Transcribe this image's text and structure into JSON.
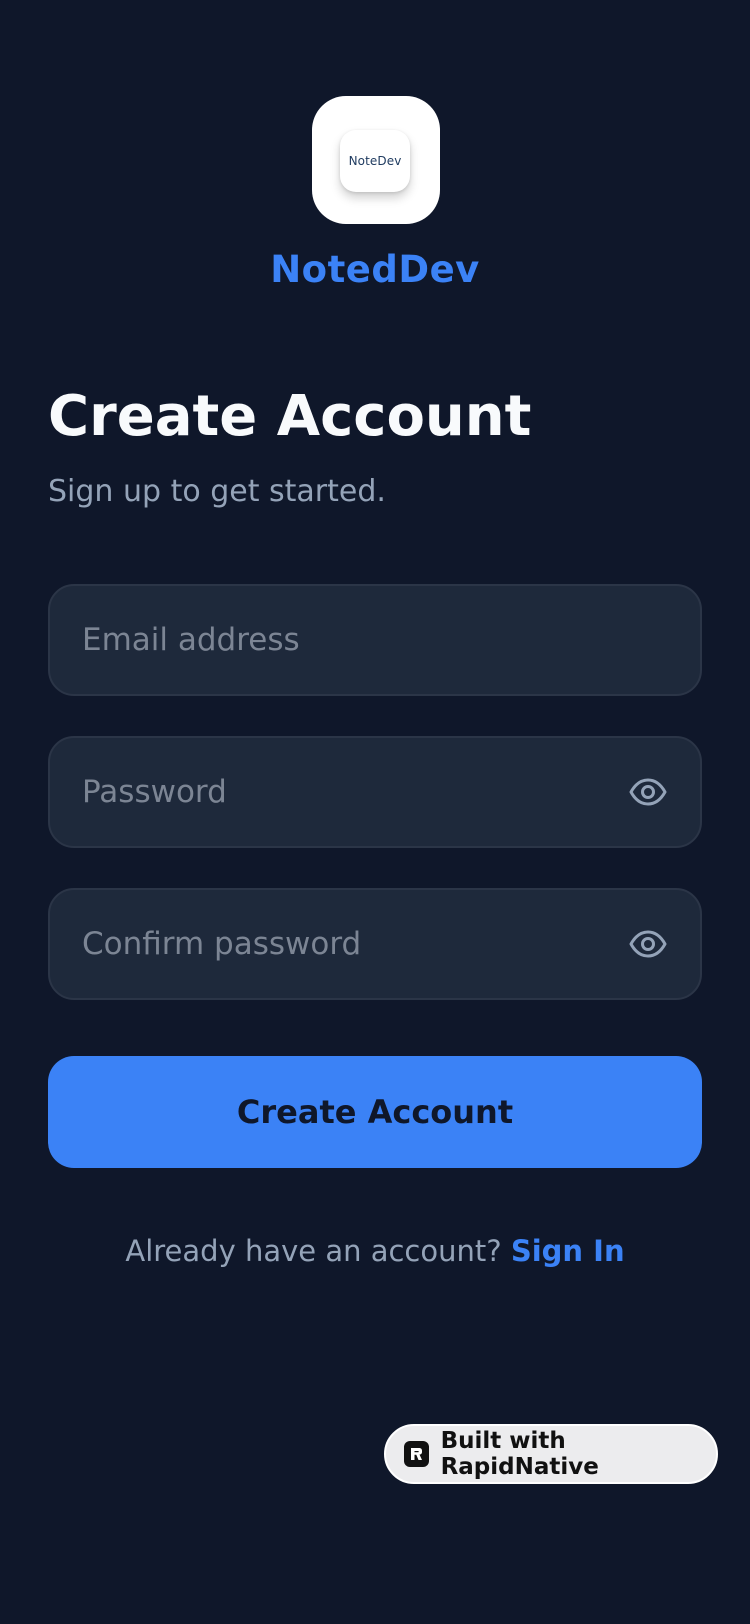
{
  "brand": {
    "logo_text": "NoteDev",
    "name": "NotedDev"
  },
  "header": {
    "title": "Create Account",
    "subtitle": "Sign up to get started."
  },
  "form": {
    "email": {
      "placeholder": "Email address",
      "value": ""
    },
    "password": {
      "placeholder": "Password",
      "value": "",
      "toggle_icon": "eye-icon"
    },
    "confirm_password": {
      "placeholder": "Confirm password",
      "value": "",
      "toggle_icon": "eye-icon"
    },
    "submit_label": "Create Account"
  },
  "footer": {
    "prompt": "Already have an account? ",
    "link_label": "Sign In"
  },
  "badge": {
    "label": "Built with RapidNative",
    "icon": "rapidnative-logo-icon"
  },
  "colors": {
    "background": "#0f172a",
    "accent": "#3b82f6",
    "field_bg": "#1e293b",
    "heading": "#f8fafc",
    "muted": "#94a3b8"
  }
}
